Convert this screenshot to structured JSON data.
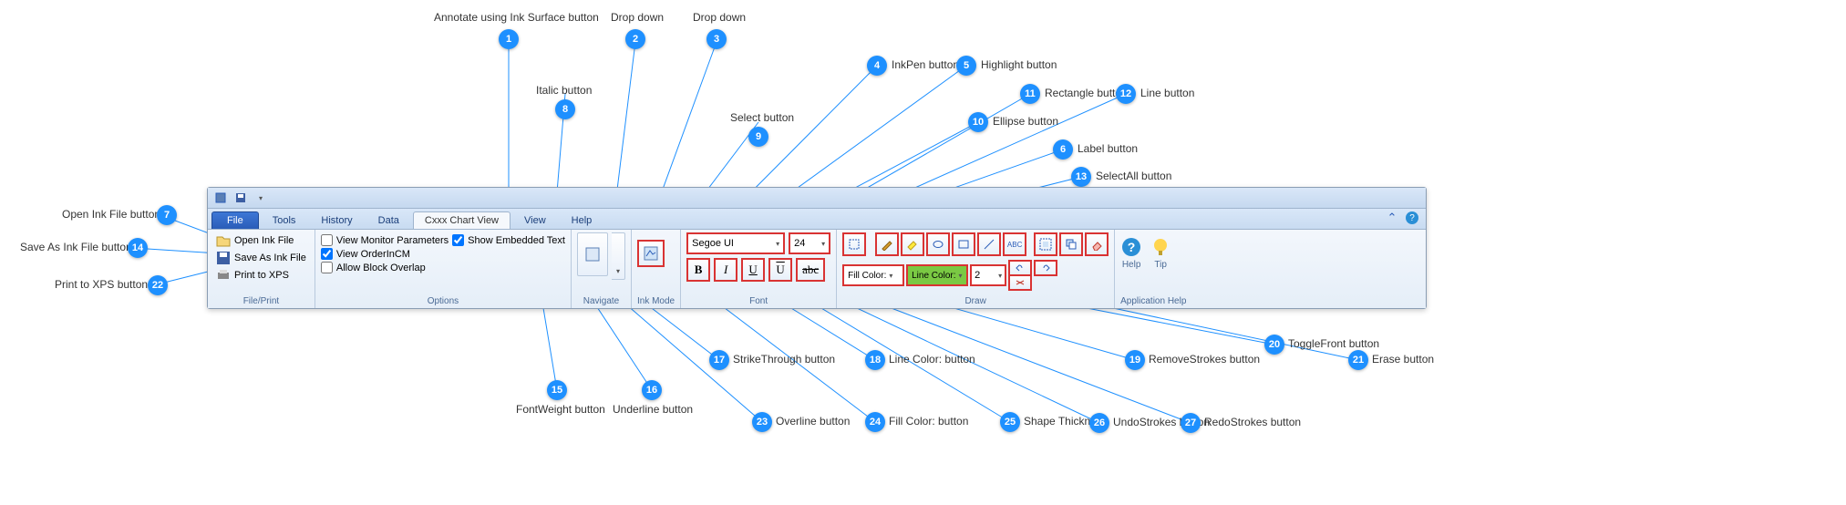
{
  "tabs": {
    "file": "File",
    "tools": "Tools",
    "history": "History",
    "data": "Data",
    "chart": "Cxxx Chart View",
    "view": "View",
    "help": "Help"
  },
  "groups": {
    "fileprint": "File/Print",
    "options": "Options",
    "navigate": "Navigate",
    "inkmode": "Ink Mode",
    "font": "Font",
    "draw": "Draw",
    "apphelp": "Application Help"
  },
  "fileprint": {
    "open": "Open Ink File",
    "save": "Save As Ink File",
    "print": "Print to XPS"
  },
  "options": {
    "viewMonitor": "View Monitor Parameters",
    "viewOrder": "View OrderInCM",
    "allowBlock": "Allow Block Overlap",
    "showEmbedded": "Show Embedded Text"
  },
  "font": {
    "name": "Segoe UI",
    "size": "24"
  },
  "draw": {
    "fillLabel": "Fill Color:",
    "lineLabel": "Line Color:",
    "thickness": "2"
  },
  "apphelp": {
    "help": "Help",
    "tip": "Tip"
  },
  "callouts": {
    "c1": "Annotate using Ink Surface button",
    "c2": "Drop down",
    "c3": "Drop down",
    "c4": "InkPen button",
    "c5": "Highlight button",
    "c6": "Label button",
    "c7": "Open Ink File button",
    "c8": "Italic button",
    "c9": "Select button",
    "c10": "Ellipse button",
    "c11": "Rectangle button",
    "c12": "Line button",
    "c13": "SelectAll button",
    "c14": "Save As Ink File button",
    "c15": "FontWeight button",
    "c16": "Underline button",
    "c17": "StrikeThrough button",
    "c18": "Line Color: button",
    "c19": "RemoveStrokes button",
    "c20": "ToggleFront button",
    "c21": "Erase button",
    "c22": "Print to XPS button",
    "c23": "Overline button",
    "c24": "Fill Color: button",
    "c25": "Shape Thickness",
    "c26": "UndoStrokes button",
    "c27": "RedoStrokes button"
  }
}
